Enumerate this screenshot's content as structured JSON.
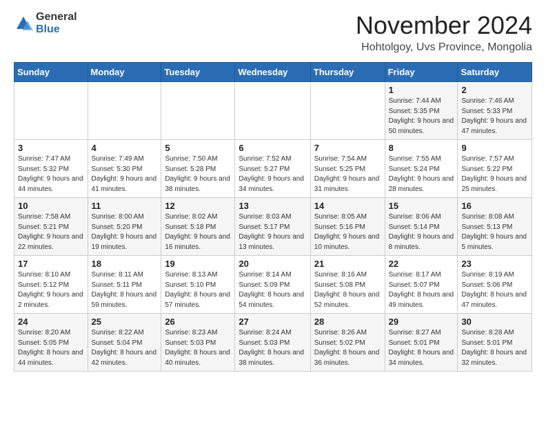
{
  "logo": {
    "general": "General",
    "blue": "Blue"
  },
  "header": {
    "month": "November 2024",
    "location": "Hohtolgoy, Uvs Province, Mongolia"
  },
  "weekdays": [
    "Sunday",
    "Monday",
    "Tuesday",
    "Wednesday",
    "Thursday",
    "Friday",
    "Saturday"
  ],
  "weeks": [
    [
      {
        "day": "",
        "info": ""
      },
      {
        "day": "",
        "info": ""
      },
      {
        "day": "",
        "info": ""
      },
      {
        "day": "",
        "info": ""
      },
      {
        "day": "",
        "info": ""
      },
      {
        "day": "1",
        "info": "Sunrise: 7:44 AM\nSunset: 5:35 PM\nDaylight: 9 hours and 50 minutes."
      },
      {
        "day": "2",
        "info": "Sunrise: 7:46 AM\nSunset: 5:33 PM\nDaylight: 9 hours and 47 minutes."
      }
    ],
    [
      {
        "day": "3",
        "info": "Sunrise: 7:47 AM\nSunset: 5:32 PM\nDaylight: 9 hours and 44 minutes."
      },
      {
        "day": "4",
        "info": "Sunrise: 7:49 AM\nSunset: 5:30 PM\nDaylight: 9 hours and 41 minutes."
      },
      {
        "day": "5",
        "info": "Sunrise: 7:50 AM\nSunset: 5:28 PM\nDaylight: 9 hours and 38 minutes."
      },
      {
        "day": "6",
        "info": "Sunrise: 7:52 AM\nSunset: 5:27 PM\nDaylight: 9 hours and 34 minutes."
      },
      {
        "day": "7",
        "info": "Sunrise: 7:54 AM\nSunset: 5:25 PM\nDaylight: 9 hours and 31 minutes."
      },
      {
        "day": "8",
        "info": "Sunrise: 7:55 AM\nSunset: 5:24 PM\nDaylight: 9 hours and 28 minutes."
      },
      {
        "day": "9",
        "info": "Sunrise: 7:57 AM\nSunset: 5:22 PM\nDaylight: 9 hours and 25 minutes."
      }
    ],
    [
      {
        "day": "10",
        "info": "Sunrise: 7:58 AM\nSunset: 5:21 PM\nDaylight: 9 hours and 22 minutes."
      },
      {
        "day": "11",
        "info": "Sunrise: 8:00 AM\nSunset: 5:20 PM\nDaylight: 9 hours and 19 minutes."
      },
      {
        "day": "12",
        "info": "Sunrise: 8:02 AM\nSunset: 5:18 PM\nDaylight: 9 hours and 16 minutes."
      },
      {
        "day": "13",
        "info": "Sunrise: 8:03 AM\nSunset: 5:17 PM\nDaylight: 9 hours and 13 minutes."
      },
      {
        "day": "14",
        "info": "Sunrise: 8:05 AM\nSunset: 5:16 PM\nDaylight: 9 hours and 10 minutes."
      },
      {
        "day": "15",
        "info": "Sunrise: 8:06 AM\nSunset: 5:14 PM\nDaylight: 9 hours and 8 minutes."
      },
      {
        "day": "16",
        "info": "Sunrise: 8:08 AM\nSunset: 5:13 PM\nDaylight: 9 hours and 5 minutes."
      }
    ],
    [
      {
        "day": "17",
        "info": "Sunrise: 8:10 AM\nSunset: 5:12 PM\nDaylight: 9 hours and 2 minutes."
      },
      {
        "day": "18",
        "info": "Sunrise: 8:11 AM\nSunset: 5:11 PM\nDaylight: 8 hours and 59 minutes."
      },
      {
        "day": "19",
        "info": "Sunrise: 8:13 AM\nSunset: 5:10 PM\nDaylight: 8 hours and 57 minutes."
      },
      {
        "day": "20",
        "info": "Sunrise: 8:14 AM\nSunset: 5:09 PM\nDaylight: 8 hours and 54 minutes."
      },
      {
        "day": "21",
        "info": "Sunrise: 8:16 AM\nSunset: 5:08 PM\nDaylight: 8 hours and 52 minutes."
      },
      {
        "day": "22",
        "info": "Sunrise: 8:17 AM\nSunset: 5:07 PM\nDaylight: 8 hours and 49 minutes."
      },
      {
        "day": "23",
        "info": "Sunrise: 8:19 AM\nSunset: 5:06 PM\nDaylight: 8 hours and 47 minutes."
      }
    ],
    [
      {
        "day": "24",
        "info": "Sunrise: 8:20 AM\nSunset: 5:05 PM\nDaylight: 8 hours and 44 minutes."
      },
      {
        "day": "25",
        "info": "Sunrise: 8:22 AM\nSunset: 5:04 PM\nDaylight: 8 hours and 42 minutes."
      },
      {
        "day": "26",
        "info": "Sunrise: 8:23 AM\nSunset: 5:03 PM\nDaylight: 8 hours and 40 minutes."
      },
      {
        "day": "27",
        "info": "Sunrise: 8:24 AM\nSunset: 5:03 PM\nDaylight: 8 hours and 38 minutes."
      },
      {
        "day": "28",
        "info": "Sunrise: 8:26 AM\nSunset: 5:02 PM\nDaylight: 8 hours and 36 minutes."
      },
      {
        "day": "29",
        "info": "Sunrise: 8:27 AM\nSunset: 5:01 PM\nDaylight: 8 hours and 34 minutes."
      },
      {
        "day": "30",
        "info": "Sunrise: 8:28 AM\nSunset: 5:01 PM\nDaylight: 8 hours and 32 minutes."
      }
    ]
  ]
}
